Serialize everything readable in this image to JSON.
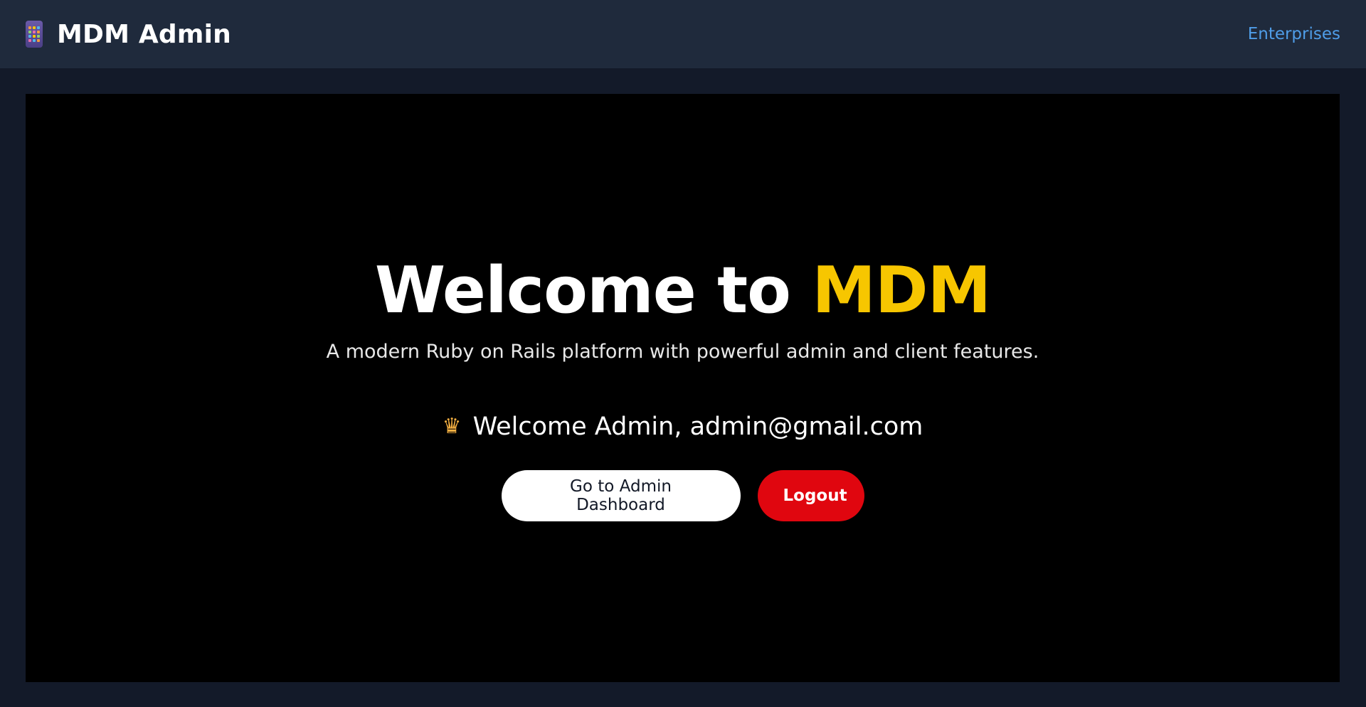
{
  "header": {
    "brand_icon": "calculator-icon",
    "brand_title": "MDM Admin",
    "nav_link": "Enterprises"
  },
  "hero": {
    "headline_prefix": "Welcome to ",
    "headline_accent": "MDM",
    "subtitle": "A modern Ruby on Rails platform with powerful admin and client features.",
    "welcome_icon": "crown-icon",
    "welcome_text": "Welcome Admin, admin@gmail.com",
    "primary_button": "Go to Admin Dashboard",
    "logout_button": "Logout"
  },
  "colors": {
    "page_bg": "#131a29",
    "header_bg": "#1f2a3c",
    "hero_bg": "#000000",
    "accent": "#f7c600",
    "link": "#4f9de8",
    "danger": "#e0060f"
  }
}
